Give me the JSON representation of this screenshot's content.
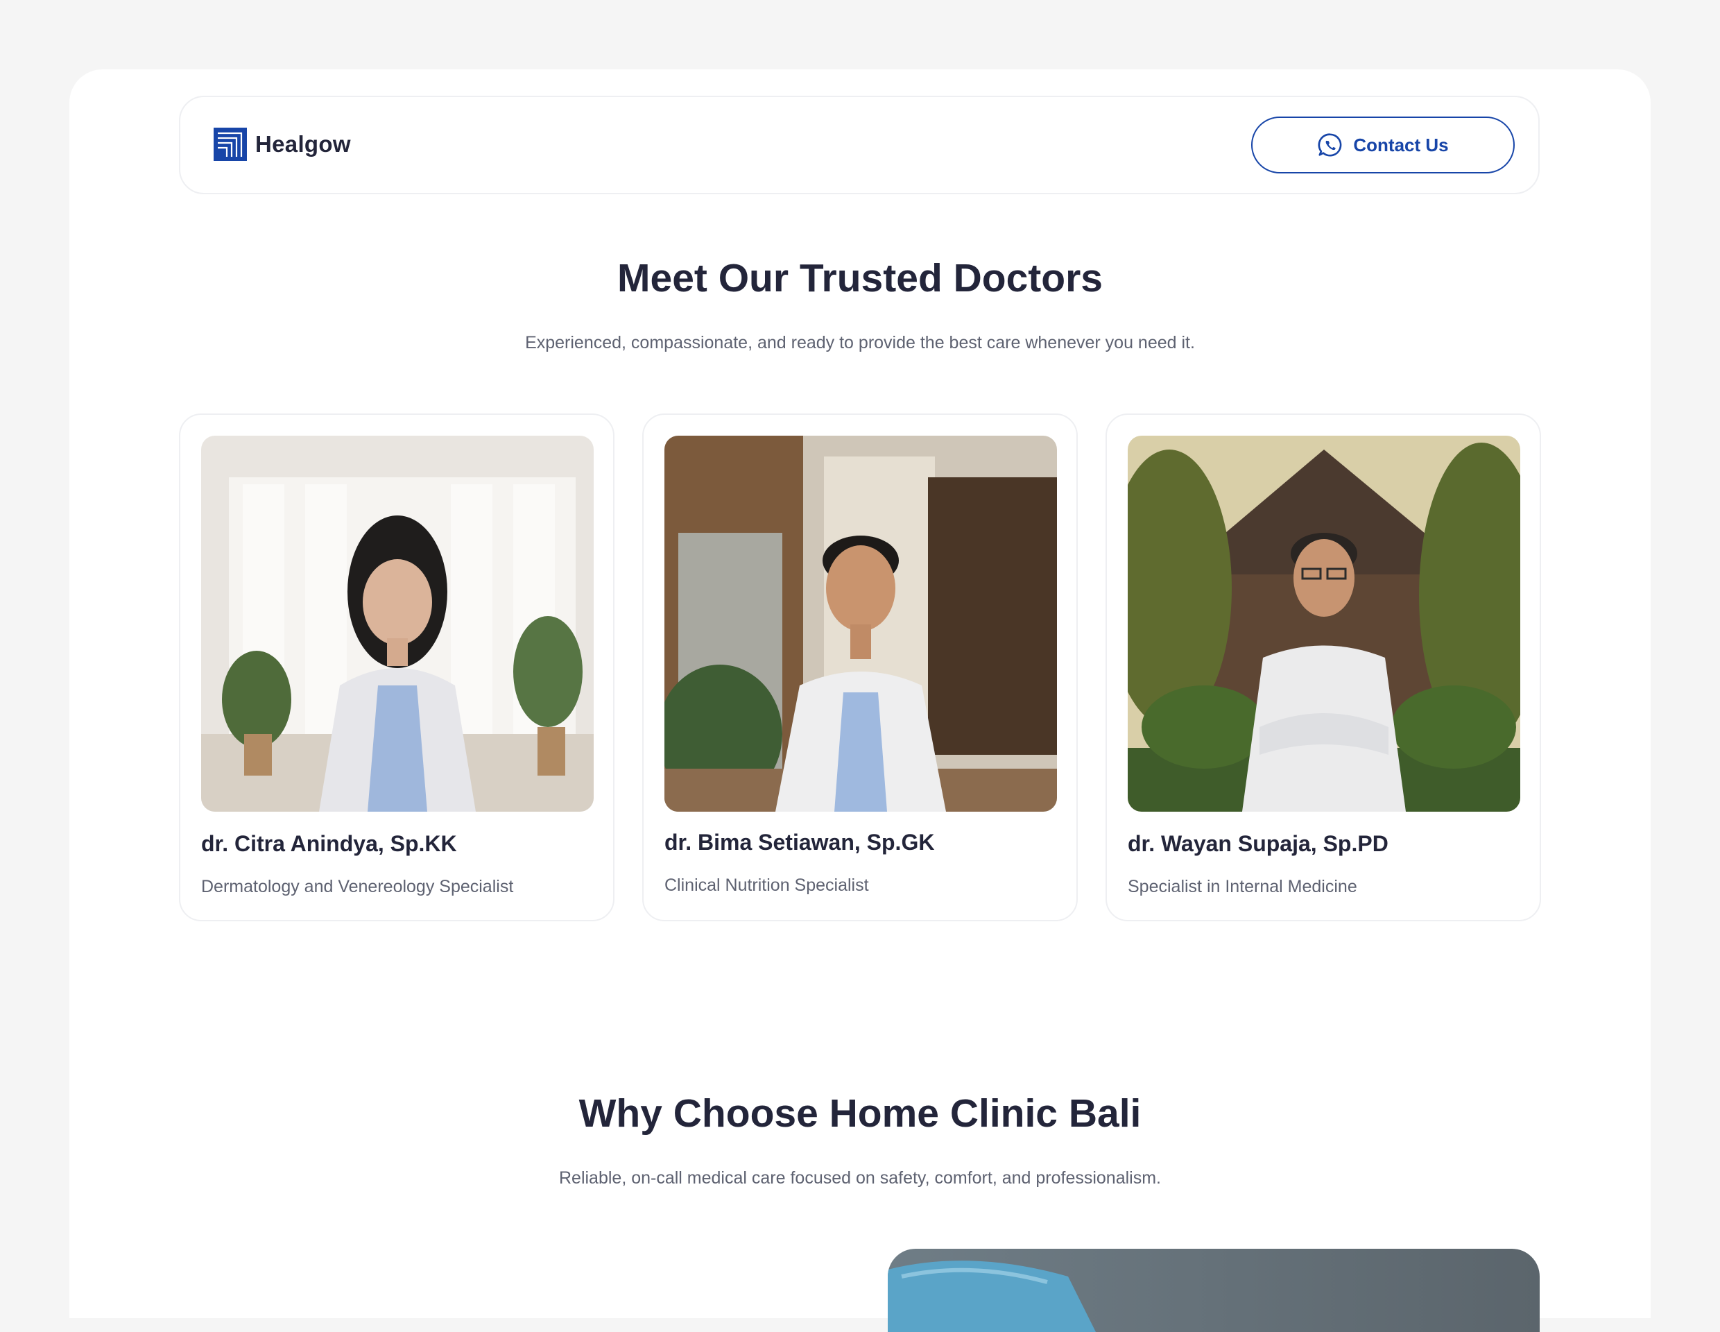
{
  "brand": {
    "name": "Healgow",
    "accent": "#1745a8"
  },
  "header": {
    "contact_label": "Contact Us",
    "contact_icon": "whatsapp-icon"
  },
  "doctors_section": {
    "title": "Meet Our Trusted Doctors",
    "subtitle": "Experienced, compassionate, and ready to provide the best care whenever you need it.",
    "doctors": [
      {
        "name": "dr. Citra Anindya, Sp.KK",
        "specialty": "Dermatology and Venereology Specialist"
      },
      {
        "name": "dr. Bima Setiawan, Sp.GK",
        "specialty": "Clinical Nutrition Specialist"
      },
      {
        "name": "dr. Wayan Supaja, Sp.PD",
        "specialty": "Specialist in Internal Medicine"
      }
    ]
  },
  "why_section": {
    "title": "Why Choose Home Clinic Bali",
    "subtitle": "Reliable, on-call medical care focused on safety, comfort, and professionalism."
  }
}
